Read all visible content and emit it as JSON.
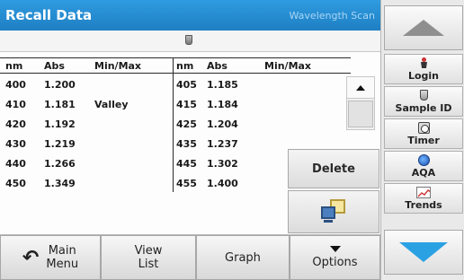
{
  "header": {
    "title": "Recall Data",
    "subtitle": "Wavelength Scan"
  },
  "table": {
    "columns": [
      "nm",
      "Abs",
      "Min/Max",
      "nm",
      "Abs",
      "Min/Max"
    ],
    "rows": [
      {
        "nm1": "400",
        "abs1": "1.200",
        "mm1": "",
        "nm2": "405",
        "abs2": "1.185"
      },
      {
        "nm1": "410",
        "abs1": "1.181",
        "mm1": "Valley",
        "nm2": "415",
        "abs2": "1.184"
      },
      {
        "nm1": "420",
        "abs1": "1.192",
        "mm1": "",
        "nm2": "425",
        "abs2": "1.204"
      },
      {
        "nm1": "430",
        "abs1": "1.219",
        "mm1": "",
        "nm2": "435",
        "abs2": "1.237"
      },
      {
        "nm1": "440",
        "abs1": "1.266",
        "mm1": "",
        "nm2": "445",
        "abs2": "1.302"
      },
      {
        "nm1": "450",
        "abs1": "1.349",
        "mm1": "",
        "nm2": "455",
        "abs2": "1.400"
      }
    ]
  },
  "actions": {
    "delete_label": "Delete"
  },
  "bottom": {
    "main_menu_line1": "Main",
    "main_menu_line2": "Menu",
    "view_list_line1": "View",
    "view_list_line2": "List",
    "graph_label": "Graph",
    "options_label": "Options"
  },
  "sidebar": {
    "login_label": "Login",
    "sample_id_label": "Sample ID",
    "timer_label": "Timer",
    "aqa_label": "AQA",
    "trends_label": "Trends"
  },
  "colors": {
    "header_blue": "#1f7fc3",
    "arrow_blue": "#2aa1e3"
  }
}
